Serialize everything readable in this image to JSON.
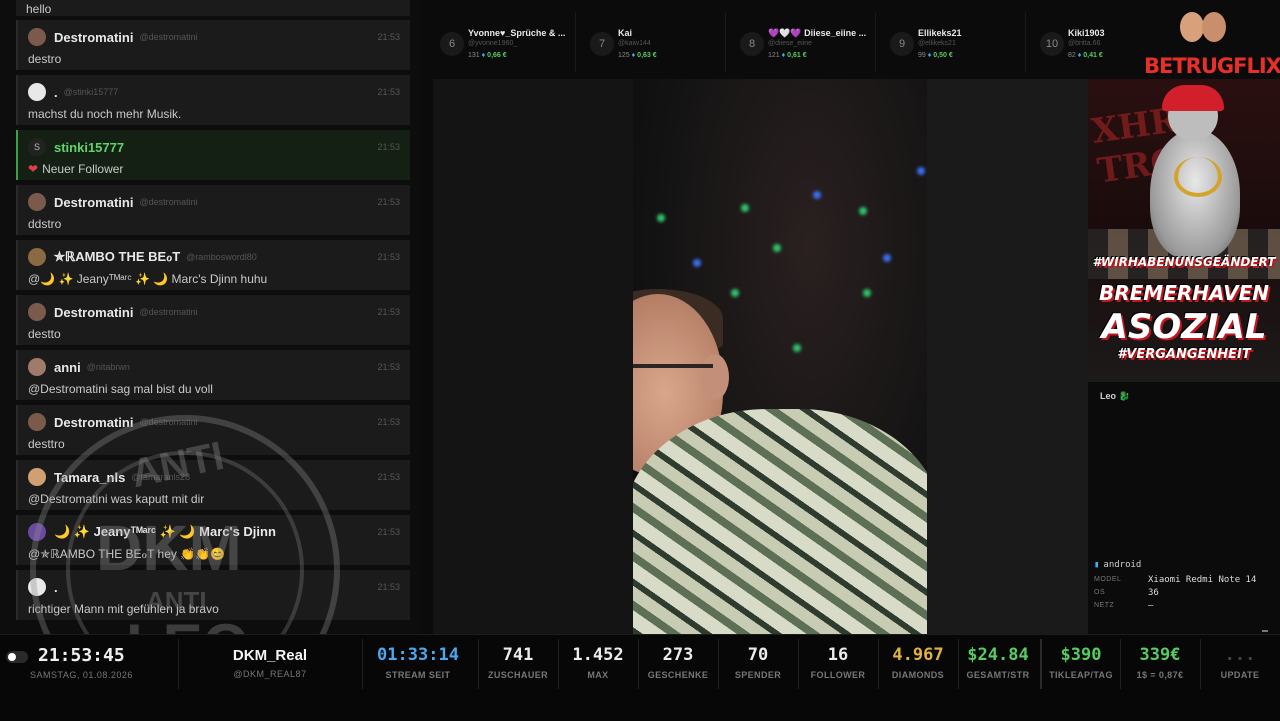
{
  "chat": {
    "top_fragment": "hello",
    "messages": [
      {
        "user": "Destromatini",
        "handle": "@destromatini",
        "time": "21:53",
        "text": "destro"
      },
      {
        "user": ".",
        "handle": "@stinki15777",
        "time": "21:53",
        "text": "machst du noch mehr Musik."
      },
      {
        "user": "stinki15777",
        "handle": "",
        "time": "21:53",
        "text": "Neuer Follower",
        "type": "follow",
        "avatar_letter": "S"
      },
      {
        "user": "Destromatini",
        "handle": "@destromatini",
        "time": "21:53",
        "text": "ddstro"
      },
      {
        "user": "✯ℝAMBO THE BEℴT",
        "handle": "@ramboswordl80",
        "time": "21:53",
        "text": "@🌙 ✨ Jeanyᵀᴹᵃʳᶜ ✨ 🌙 Marc's Djinn huhu"
      },
      {
        "user": "Destromatini",
        "handle": "@destromatini",
        "time": "21:53",
        "text": "destto"
      },
      {
        "user": "anni",
        "handle": "@nitabrwn",
        "time": "21:53",
        "text": "@Destromatini sag mal bist du voll"
      },
      {
        "user": "Destromatini",
        "handle": "@destromatini",
        "time": "21:53",
        "text": "desttro"
      },
      {
        "user": "Tamara_nls",
        "handle": "@tamaranls28",
        "time": "21:53",
        "text": "@Destromatini was kaputt mit dir"
      },
      {
        "user": "🌙 ✨ Jeanyᵀᴹᵃʳᶜ ✨ 🌙 Marc's Djinn",
        "handle": "",
        "time": "21:53",
        "text": "@✯ℝAMBO THE BEℴT hey 👏👏😊"
      },
      {
        "user": ".",
        "handle": "",
        "time": "21:53",
        "text": "richtiger Mann mit gefühlen ja bravo"
      }
    ]
  },
  "stamp": {
    "t1": "ANTI",
    "t2": "DKM",
    "t3": "ANTI",
    "t4": "LEO"
  },
  "leaderboard": [
    {
      "rank": "6",
      "name": "Yvonne♥_Sprüche & ...",
      "handle": "@yvonne1960_",
      "count": "131",
      "euro": "0,66 €"
    },
    {
      "rank": "7",
      "name": "Kai",
      "handle": "@kaiw144",
      "count": "125",
      "euro": "0,63 €"
    },
    {
      "rank": "8",
      "name": "💜🤍💜 Diiese_eiine ...",
      "handle": "@diiese_eiine",
      "count": "121",
      "euro": "0,61 €"
    },
    {
      "rank": "9",
      "name": "Ellikeks21",
      "handle": "@ellikeks21",
      "count": "99",
      "euro": "0,50 €"
    },
    {
      "rank": "10",
      "name": "Kiki1903",
      "handle": "@britta.66",
      "count": "82",
      "euro": "0,41 €"
    }
  ],
  "logo": {
    "text": "BETRUGFLIX"
  },
  "poster": {
    "graffiti": "XHR TROM",
    "line1": "#WIRHABENUNSGEÄNDERT",
    "line2": "BREMERHAVEN",
    "line3": "ASOZIAL",
    "line4": "#VERGANGENHEIT"
  },
  "viewer_tag": "Leo 🐉",
  "device": {
    "platform": "android",
    "rows": [
      {
        "key": "MODEL",
        "value": "Xiaomi Redmi Note 14"
      },
      {
        "key": "OS",
        "value": "36"
      },
      {
        "key": "NETZ",
        "value": "—"
      }
    ]
  },
  "bottom_bar": {
    "clock": "21:53:45",
    "date": "SAMSTAG, 01.08.2026",
    "channel_name": "DKM_Real",
    "channel_handle": "@DKM_REAL87",
    "stats": [
      {
        "value": "01:33:14",
        "label": "STREAM SEIT"
      },
      {
        "value": "741",
        "label": "ZUSCHAUER"
      },
      {
        "value": "1.452",
        "label": "MAX"
      },
      {
        "value": "273",
        "label": "GESCHENKE"
      },
      {
        "value": "70",
        "label": "SPENDER"
      },
      {
        "value": "16",
        "label": "FOLLOWER"
      },
      {
        "value": "4.967",
        "label": "DIAMONDS"
      },
      {
        "value": "$24.84",
        "label": "GESAMT/STR"
      },
      {
        "value": "$390",
        "label": "TIKLEAP/TAG"
      },
      {
        "value": "339€",
        "label": "1$ = 0,87€"
      },
      {
        "value": "...",
        "label": "UPDATE"
      }
    ]
  },
  "colors": {
    "accent_green": "#57cc61",
    "accent_blue": "#4aa8f0",
    "accent_gold": "#e3b341",
    "follow_heart": "#e43c4a",
    "logo_red": "#e63028"
  }
}
